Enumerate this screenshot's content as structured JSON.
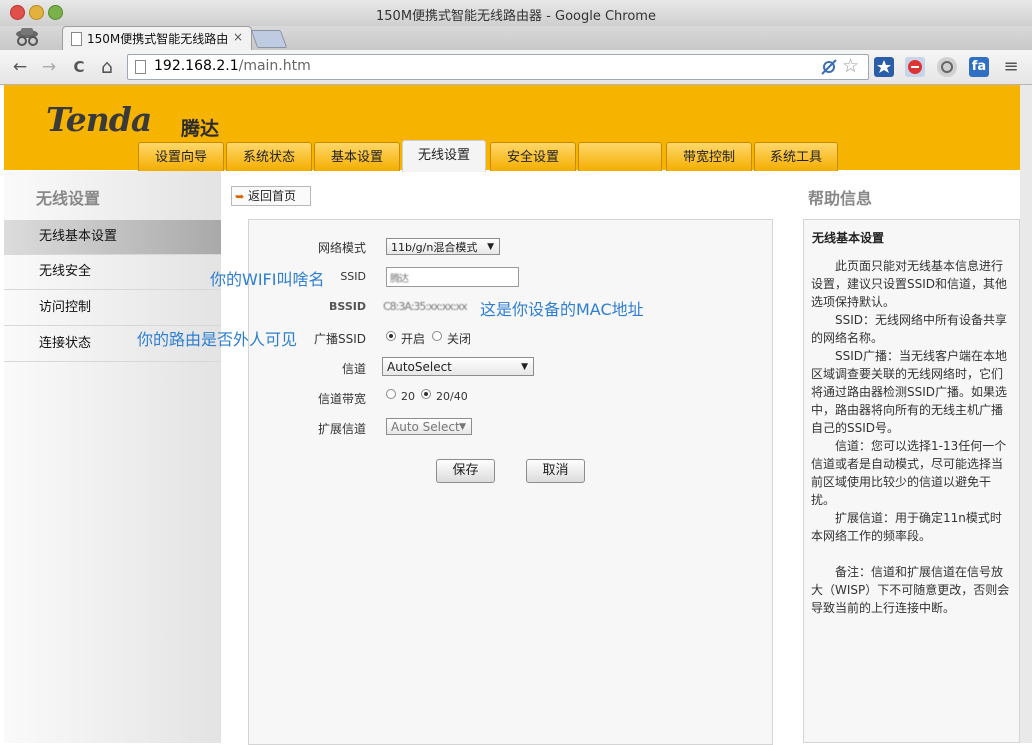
{
  "window": {
    "title": "150M便携式智能无线路由器 - Google Chrome"
  },
  "browser": {
    "tab_title": "150M便携式智能无线路由器",
    "tab_close": "×",
    "url_host": "192.168.2.1",
    "url_path": "/main.htm",
    "back": "←",
    "forward": "→",
    "reload": "C",
    "home": "⌂",
    "star": "☆",
    "menu": "≡",
    "ext_icon": "fa"
  },
  "brand": {
    "logo": "Tenda",
    "logo_cn": "腾达"
  },
  "nav_tabs": [
    "设置向导",
    "系统状态",
    "基本设置",
    "无线设置",
    "安全设置",
    "",
    "带宽控制",
    "系统工具"
  ],
  "sidebar": {
    "title": "无线设置",
    "items": [
      "无线基本设置",
      "无线安全",
      "访问控制",
      "连接状态"
    ]
  },
  "home_button": "返回首页",
  "form": {
    "network_mode_label": "网络模式",
    "network_mode_value": "11b/g/n混合模式",
    "ssid_label": "SSID",
    "ssid_value": "腾达",
    "bssid_label": "BSSID",
    "bssid_value": "C8:3A:35:xx:xx:xx",
    "broadcast_label": "广播SSID",
    "broadcast_on": "开启",
    "broadcast_off": "关闭",
    "channel_label": "信道",
    "channel_value": "AutoSelect",
    "bandwidth_label": "信道带宽",
    "bw_20": "20",
    "bw_2040": "20/40",
    "ext_channel_label": "扩展信道",
    "ext_channel_value": "Auto Select",
    "save": "保存",
    "cancel": "取消"
  },
  "annotations": {
    "wifi_name": "你的WIFI叫啥名",
    "mac": "这是你设备的MAC地址",
    "visible": "你的路由是否外人可见"
  },
  "help": {
    "title": "帮助信息",
    "heading": "无线基本设置",
    "p1": "此页面只能对无线基本信息进行设置，建议只设置SSID和信道，其他选项保持默认。",
    "p2": "SSID：无线网络中所有设备共享的网络名称。",
    "p3": "SSID广播：当无线客户端在本地区域调查要关联的无线网络时，它们将通过路由器检测SSID广播。如果选中，路由器将向所有的无线主机广播自己的SSID号。",
    "p4": "信道：您可以选择1-13任何一个信道或者是自动模式，尽可能选择当前区域使用比较少的信道以避免干扰。",
    "p5": "扩展信道：用于确定11n模式时本网络工作的频率段。",
    "p6": "备注：信道和扩展信道在信号放大（WISP）下不可随意更改，否则会导致当前的上行连接中断。"
  },
  "colors": {
    "header": "#f6b400",
    "annotation": "#2e7fd2"
  }
}
